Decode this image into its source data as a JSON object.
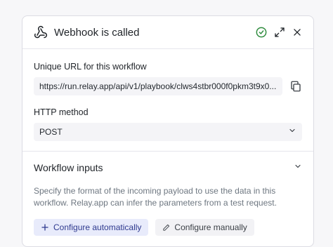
{
  "card": {
    "title": "Webhook is called",
    "icons": {
      "trigger": "webhook-icon",
      "status": "check-circle-icon",
      "expand": "expand-icon",
      "close": "close-icon"
    }
  },
  "url_section": {
    "label": "Unique URL for this workflow",
    "url": "https://run.relay.app/api/v1/playbook/clws4stbr000f0pkm3t9x0...",
    "copy_icon": "copy-icon"
  },
  "method_section": {
    "label": "HTTP method",
    "value": "POST",
    "chevron_icon": "chevron-down-icon"
  },
  "inputs_section": {
    "title": "Workflow inputs",
    "description": "Specify the format of the incoming payload to use the data in this workflow. Relay.app can infer the parameters from a test request.",
    "configure_auto_label": "Configure automatically",
    "configure_manual_label": "Configure manually"
  },
  "colors": {
    "accent": "#2f3a8f",
    "success": "#2e8b3d",
    "primary_button_bg": "#e8ebfb"
  }
}
